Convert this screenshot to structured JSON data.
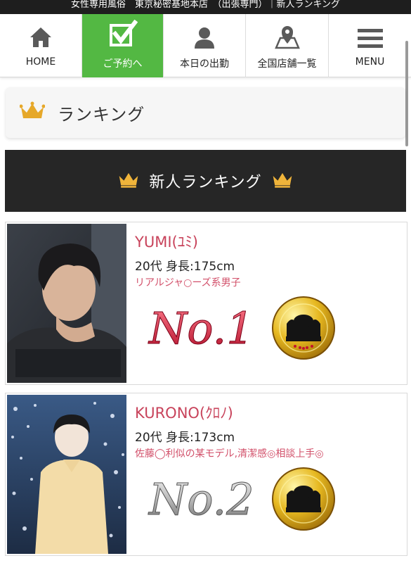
{
  "header": {
    "text": "女性専用風俗　東京秘密基地本店　（出張専門）｜新人ランキング"
  },
  "nav": {
    "items": [
      {
        "label": "HOME",
        "icon": "home-icon"
      },
      {
        "label": "ご予約へ",
        "icon": "check-icon"
      },
      {
        "label": "本日の出勤",
        "icon": "person-icon"
      },
      {
        "label": "全国店舗一覧",
        "icon": "map-pin-icon"
      },
      {
        "label": "MENU",
        "icon": "hamburger-menu-icon"
      }
    ]
  },
  "section": {
    "title": "ランキング"
  },
  "banner": {
    "title": "新人ランキング"
  },
  "colors": {
    "accent_green": "#53b843",
    "crown_gold": "#e6a82a",
    "name_pink": "#c8435b",
    "dark": "#262626"
  },
  "ranking": [
    {
      "name": "YUMI(ﾕﾐ)",
      "spec": "20代 身長:175cm",
      "catch": "リアルジャ○ーズ系男子",
      "rank": "No.1"
    },
    {
      "name": "KURONO(ｸﾛﾉ)",
      "spec": "20代 身長:173cm",
      "catch": "佐藤◯利似の某モデル,清潔感◎相談上手◎",
      "rank": "No.2"
    }
  ]
}
